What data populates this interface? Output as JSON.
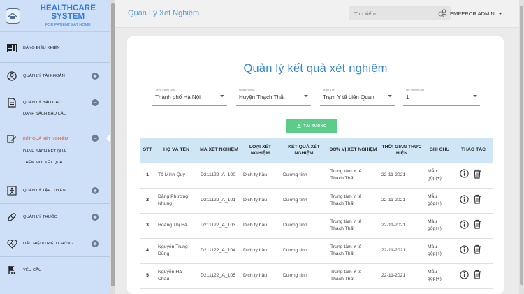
{
  "sidebar": {
    "brand_title": "HEALTHCARE SYSTEM",
    "brand_subtitle": "FOR PATIENTS AT HOME",
    "items": [
      {
        "label": "BẢNG ĐIỀU KHIỂN",
        "icon": "dashboard-icon"
      },
      {
        "label": "QUẢN LÝ TÀI KHOẢN",
        "icon": "user-circle-icon",
        "toggle": "+"
      },
      {
        "label": "QUẢN LÝ BÁO CÁO",
        "icon": "document-icon",
        "toggle": "−",
        "sub": [
          "DANH SÁCH BÁO CÁO"
        ]
      },
      {
        "label": "KẾT QUẢ XÉT NGHIỆM",
        "icon": "edit-document-icon",
        "toggle": "−",
        "active": true,
        "sub": [
          "DANH SÁCH KẾT QUẢ",
          "THÊM MỚI KẾT QUẢ"
        ]
      },
      {
        "label": "QUẢN LÝ TẬP LUYỆN",
        "icon": "exercise-icon",
        "toggle": "+"
      },
      {
        "label": "QUẢN LÝ THUỐC",
        "icon": "pill-icon",
        "toggle": "+"
      },
      {
        "label": "DẤU HIỆU/TRIỆU CHỨNG",
        "icon": "heart-pulse-icon",
        "toggle": "+"
      },
      {
        "label": "YÊU CẦU",
        "icon": "request-icon"
      }
    ]
  },
  "header": {
    "title": "Quản Lý Xét Nghiệm",
    "search_placeholder": "Tìm kiếm...",
    "username": "EMPEROR ADMIN"
  },
  "main": {
    "title": "Quản lý kết quả xét nghiệm",
    "filters": [
      {
        "label": "Tỉnh/Thành phố",
        "value": "Thành phố Hà Nội"
      },
      {
        "label": "Quận/Huyện",
        "value": "Huyện Thạch Thất"
      },
      {
        "label": "Trạm y tế",
        "value": "Trạm Y tế Liên Quan"
      },
      {
        "label": "xét nghiệm lần",
        "value": "1"
      }
    ],
    "download_label": "TẢI XUỐNG",
    "table": {
      "headers": [
        "STT",
        "HỌ VÀ TÊN",
        "MÃ XÉT NGHIỆM",
        "LOẠI XÉT NGHIỆM",
        "KẾT QUẢ XÉT NGHIỆM",
        "ĐƠN VỊ XÉT NGHIỆM",
        "THỜI GIAN THỰC HIỆN",
        "GHI CHÚ",
        "THAO TÁC"
      ],
      "rows": [
        {
          "stt": "1",
          "name": "Tô Minh Quý",
          "code": "D211122_A_100",
          "type": "Dịch tỵ hầu",
          "result": "Dương tính",
          "unit": "Trung tâm Y tế Thạch Thất",
          "time": "22-11-2021",
          "note": "Mẫu gộp(+)"
        },
        {
          "stt": "2",
          "name": "Đặng Phương Nhung",
          "code": "D211122_A_101",
          "type": "Dịch tỵ hầu",
          "result": "Dương tính",
          "unit": "Trung tâm Y tế Thạch Thất",
          "time": "22-11-2021",
          "note": "Mẫu gộp(+)"
        },
        {
          "stt": "3",
          "name": "Hoàng Thị Hà",
          "code": "D211122_A_103",
          "type": "Dịch tỵ hầu",
          "result": "Dương tính",
          "unit": "Trung tâm Y tế Thạch Thất",
          "time": "22-11-2021",
          "note": "Mẫu gộp(+)"
        },
        {
          "stt": "4",
          "name": "Nguyễn Trung Dũng",
          "code": "D211122_A_104",
          "type": "Dịch tỵ hầu",
          "result": "Dương tính",
          "unit": "Trung tâm Y tế Thạch Thất",
          "time": "22-11-2021",
          "note": "Mẫu gộp(+)"
        },
        {
          "stt": "5",
          "name": "Nguyễn Hải Châu",
          "code": "D211122_A_105",
          "type": "Dịch tỵ hầu",
          "result": "Dương tính",
          "unit": "Trung tâm Y tế Thạch Thất",
          "time": "22-11-2021",
          "note": "Mẫu gộp(+)"
        }
      ]
    }
  },
  "colors": {
    "accent": "#2f86db",
    "sidebar": "#cde0f7",
    "active": "#e0522d",
    "download": "#5ccc8b"
  }
}
